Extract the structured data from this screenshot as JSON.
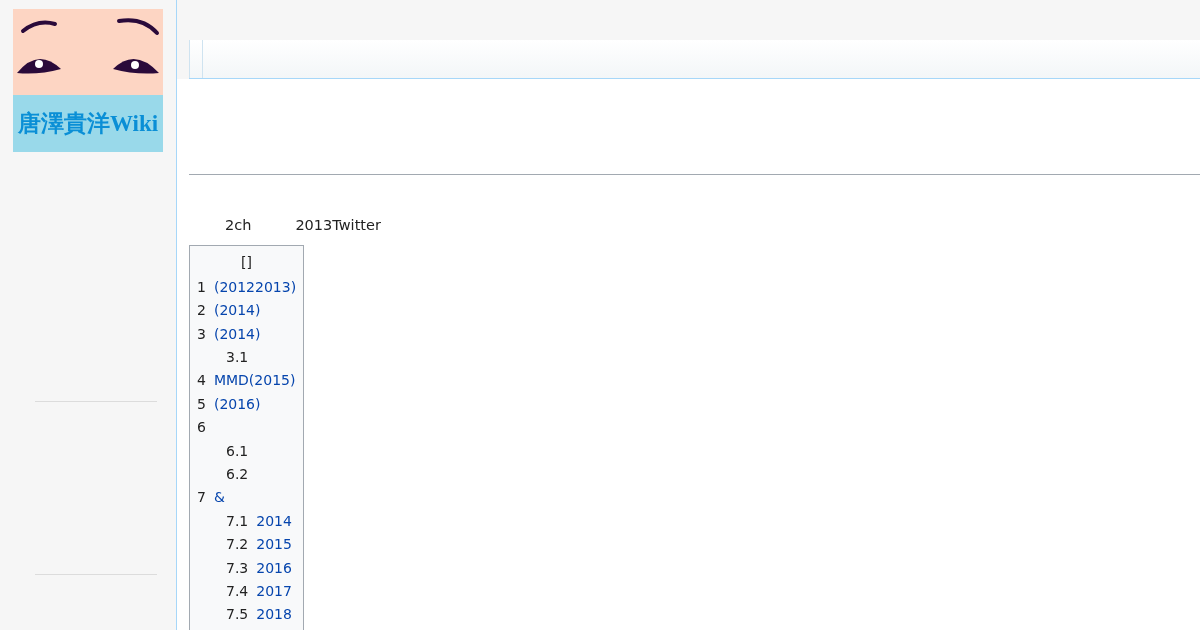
{
  "logo": {
    "text": "唐澤貴洋Wiki"
  },
  "intro": [
    "2ch",
    "2013Twitter"
  ],
  "toc": {
    "title": "[]",
    "items": [
      {
        "number": "1",
        "text": "(20122013)"
      },
      {
        "number": "2",
        "text": "(2014)"
      },
      {
        "number": "3",
        "text": "(2014)",
        "children": [
          {
            "number": "3.1"
          }
        ]
      },
      {
        "number": "4",
        "text": "MMD(2015)"
      },
      {
        "number": "5",
        "text": "(2016)"
      },
      {
        "number": "6",
        "children": [
          {
            "number": "6.1"
          },
          {
            "number": "6.2"
          }
        ]
      },
      {
        "number": "7",
        "text": "&",
        "children": [
          {
            "number": "7.1",
            "text": "2014"
          },
          {
            "number": "7.2",
            "text": "2015"
          },
          {
            "number": "7.3",
            "text": "2016"
          },
          {
            "number": "7.4",
            "text": "2017"
          },
          {
            "number": "7.5",
            "text": "2018"
          }
        ]
      }
    ]
  }
}
